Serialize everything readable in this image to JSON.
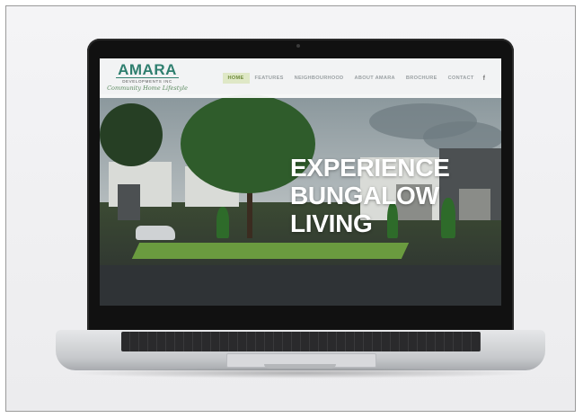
{
  "logo": {
    "title": "AMARA",
    "subtitle": "DEVELOPMENTS INC",
    "tagline": "Community Home Lifestyle"
  },
  "nav": {
    "items": [
      "HOME",
      "FEATURES",
      "NEIGHBOURHOOD",
      "ABOUT AMARA",
      "BROCHURE",
      "CONTACT"
    ],
    "active": "HOME",
    "social": "f"
  },
  "hero": {
    "lines": [
      "EXPERIENCE",
      "BUNGALOW",
      "LIVING"
    ]
  },
  "colors": {
    "logo": "#2f7f6f",
    "nav_active_bg": "#dfe8c6",
    "nav_active_text": "#6e8a3a",
    "hero_text": "#ffffff"
  }
}
